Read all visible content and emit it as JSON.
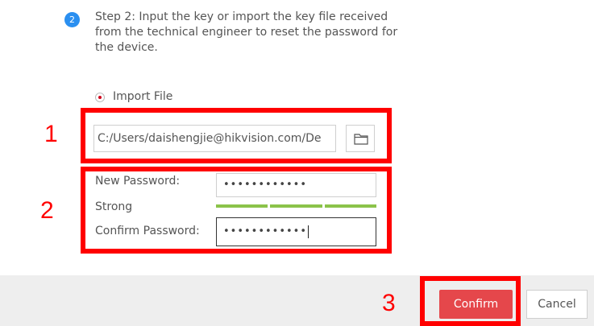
{
  "step": {
    "number": "2",
    "text": "Step 2: Input the key or import the key file received from the technical engineer to reset the password for the device."
  },
  "import": {
    "radio_label": "Import File",
    "file_path": "C:/Users/daishengjie@hikvision.com/De"
  },
  "password": {
    "new_label": "New Password:",
    "new_value": "••••••••••••",
    "strength_label": "Strong",
    "strength_level": 3,
    "strength_max": 3,
    "confirm_label": "Confirm Password:",
    "confirm_value": "••••••••••••"
  },
  "buttons": {
    "confirm": "Confirm",
    "cancel": "Cancel"
  },
  "annotations": [
    "1",
    "2",
    "3"
  ],
  "colors": {
    "accent_blue": "#2a8ff0",
    "confirm_red": "#e5474b",
    "strength_green": "#8bc34a",
    "annotation_red": "#ff0000"
  }
}
